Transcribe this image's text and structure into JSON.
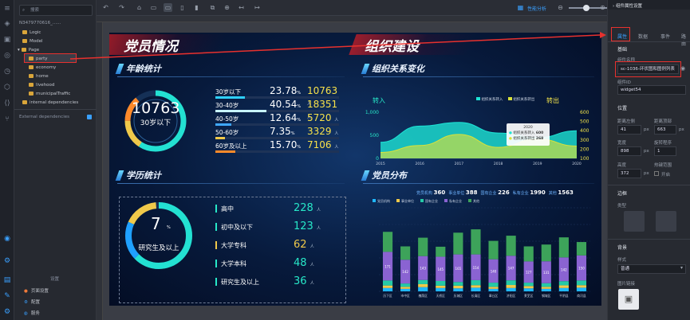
{
  "tree": {
    "search_placeholder": "搜索",
    "project": "N3479770616_......",
    "items": [
      "Logic",
      "Model",
      "Page",
      "party",
      "economy",
      "home",
      "livehood",
      "municipalTraffic",
      "internal dependencies"
    ],
    "external": "External dependencies",
    "settings_title": "设置",
    "settings": [
      "页面设置",
      "配置",
      "服务"
    ]
  },
  "toolbar": {
    "perf_label": "性能分析"
  },
  "dashboard": {
    "title_left": "党员情况",
    "title_right": "组织建设",
    "age": {
      "section": "年龄统计",
      "total": "10763",
      "center_label": "30岁以下",
      "unit_pct": "%",
      "unit_people": "人",
      "rows": [
        {
          "label": "30岁以下",
          "pct": "23.78",
          "count": "10763",
          "fill": 0.24,
          "color": "#2fd0ff"
        },
        {
          "label": "30-40岁",
          "pct": "40.54",
          "count": "18351",
          "fill": 0.41,
          "color": "#c7f4ff"
        },
        {
          "label": "40-50岁",
          "pct": "12.64",
          "count": "5720",
          "fill": 0.13,
          "color": "#3fa8ff"
        },
        {
          "label": "50-60岁",
          "pct": "7.35",
          "count": "3329",
          "fill": 0.08,
          "color": "#f0c94a"
        },
        {
          "label": "60岁及以上",
          "pct": "15.70",
          "count": "7106",
          "fill": 0.16,
          "color": "#ff8a2a"
        }
      ]
    },
    "edu": {
      "section": "学历统计",
      "big": "7",
      "big_unit": "%",
      "center_label": "研究生及以上",
      "unit_people": "人",
      "rows": [
        {
          "label": "高中",
          "value": "228"
        },
        {
          "label": "初中及以下",
          "value": "123"
        },
        {
          "label": "大学专科",
          "value": "62"
        },
        {
          "label": "大学本科",
          "value": "48"
        },
        {
          "label": "研究生及以上",
          "value": "36"
        }
      ],
      "row_colors": [
        "#27e8c8",
        "#27e8c8",
        "#f0c94a",
        "#27e8c8",
        "#27e8c8"
      ]
    },
    "org": {
      "section": "组织关系变化",
      "in_label": "转入",
      "out_label": "转出",
      "legend": [
        "组织关系转入",
        "组织关系转出"
      ],
      "tooltip": {
        "year": "2020",
        "in_label": "组织关系转入",
        "in_val": "600",
        "out_label": "组织关系转出",
        "out_val": "268"
      },
      "left_ticks": [
        "1,000",
        "500",
        "0"
      ],
      "right_ticks": [
        "600",
        "500",
        "400",
        "300",
        "200",
        "100"
      ]
    },
    "dist": {
      "section": "党员分布",
      "summary": [
        {
          "label": "党员机构",
          "value": "360"
        },
        {
          "label": "事业单位",
          "value": "388"
        },
        {
          "label": "国有企业",
          "value": "226"
        },
        {
          "label": "私有企业",
          "value": "1990"
        },
        {
          "label": "其他",
          "value": "1563"
        }
      ],
      "legend": [
        "党员机构",
        "事业单位",
        "国有企业",
        "私有企业",
        "其他"
      ]
    }
  },
  "chart_data": [
    {
      "type": "area",
      "title": "组织关系变化",
      "x": [
        "2015",
        "2016",
        "2017",
        "2018",
        "2019",
        "2020"
      ],
      "series": [
        {
          "name": "组织关系转入",
          "values": [
            350,
            700,
            780,
            550,
            450,
            600
          ],
          "color": "#1de3d5"
        },
        {
          "name": "组织关系转出",
          "values": [
            130,
            280,
            520,
            240,
            420,
            268
          ],
          "color": "#d9e23a"
        }
      ],
      "ylim": [
        0,
        1000
      ],
      "legend_position": "top-center"
    },
    {
      "type": "bar",
      "title": "党员分布",
      "categories": [
        "历下区",
        "市中区",
        "槐荫区",
        "天桥区",
        "历城区",
        "长清区",
        "章丘区",
        "济阳区",
        "莱芜区",
        "钢城区",
        "平阴县",
        "商河县"
      ],
      "series": [
        {
          "name": "党员机构",
          "values": [
            20,
            15,
            25,
            20,
            18,
            22,
            15,
            20,
            18,
            15,
            20,
            22
          ],
          "color": "#1fb8ff"
        },
        {
          "name": "事业单位",
          "values": [
            15,
            12,
            18,
            14,
            16,
            15,
            12,
            18,
            14,
            12,
            16,
            15
          ],
          "color": "#f0c94a"
        },
        {
          "name": "国有企业",
          "values": [
            30,
            20,
            25,
            28,
            22,
            30,
            25,
            28,
            20,
            22,
            25,
            28
          ],
          "color": "#26c9a6"
        },
        {
          "name": "私有企业",
          "values": [
            171,
            142,
            143,
            145,
            165,
            154,
            140,
            147,
            127,
            131,
            142,
            150
          ],
          "color": "#8a63d2"
        },
        {
          "name": "其他",
          "values": [
            120,
            80,
            110,
            60,
            130,
            150,
            110,
            120,
            90,
            100,
            120,
            80
          ],
          "color": "#3da35a"
        }
      ],
      "ylim": [
        0,
        500
      ]
    }
  ],
  "right_panel": {
    "header": "组件属性设置",
    "tabs": [
      "属性",
      "数据",
      "事件",
      "路由"
    ],
    "basic": "基础",
    "comp_name_label": "组件名称",
    "comp_name": "sc-1036-环状图和图例列表",
    "comp_id_label": "组件ID",
    "comp_id": "widget54",
    "position": "位置",
    "left_label": "距离左侧",
    "top_label": "距离顶部",
    "left_val": "41",
    "top_val": "663",
    "px": "px",
    "width_label": "宽度",
    "rot_label": "旋转程序",
    "width_val": "898",
    "rot_val": "1",
    "height_label": "高度",
    "lock_label": "热键范围",
    "height_val": "372",
    "open_label": "开启",
    "border": "边框",
    "type": "类型",
    "background": "背景",
    "style_label": "样式",
    "style_val": "普通",
    "img_label": "图片链接"
  }
}
